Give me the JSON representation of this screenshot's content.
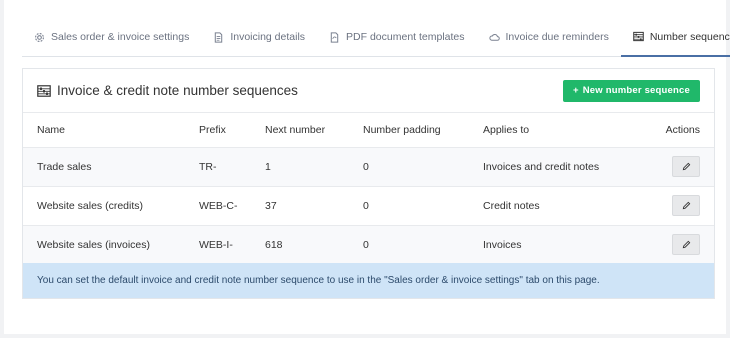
{
  "tabs": [
    {
      "label": "Sales order & invoice settings",
      "icon": "gear-icon"
    },
    {
      "label": "Invoicing details",
      "icon": "document-icon"
    },
    {
      "label": "PDF document templates",
      "icon": "pdf-icon"
    },
    {
      "label": "Invoice due reminders",
      "icon": "cloud-icon"
    },
    {
      "label": "Number sequences",
      "icon": "abacus-icon"
    }
  ],
  "panel": {
    "title": "Invoice & credit note number sequences",
    "new_button": "New number sequence"
  },
  "table": {
    "headers": [
      "Name",
      "Prefix",
      "Next number",
      "Number padding",
      "Applies to",
      "Actions"
    ],
    "rows": [
      {
        "name": "Trade sales",
        "prefix": "TR-",
        "next": "1",
        "padding": "0",
        "applies": "Invoices and credit notes"
      },
      {
        "name": "Website sales (credits)",
        "prefix": "WEB-C-",
        "next": "37",
        "padding": "0",
        "applies": "Credit notes"
      },
      {
        "name": "Website sales (invoices)",
        "prefix": "WEB-I-",
        "next": "618",
        "padding": "0",
        "applies": "Invoices"
      }
    ]
  },
  "info_text": "You can set the default invoice and credit note number sequence to use in the \"Sales order & invoice settings\" tab on this page.",
  "colors": {
    "accent": "#20b86a",
    "info_bg": "#cfe4f7",
    "active_tab": "#4a6fa5"
  }
}
